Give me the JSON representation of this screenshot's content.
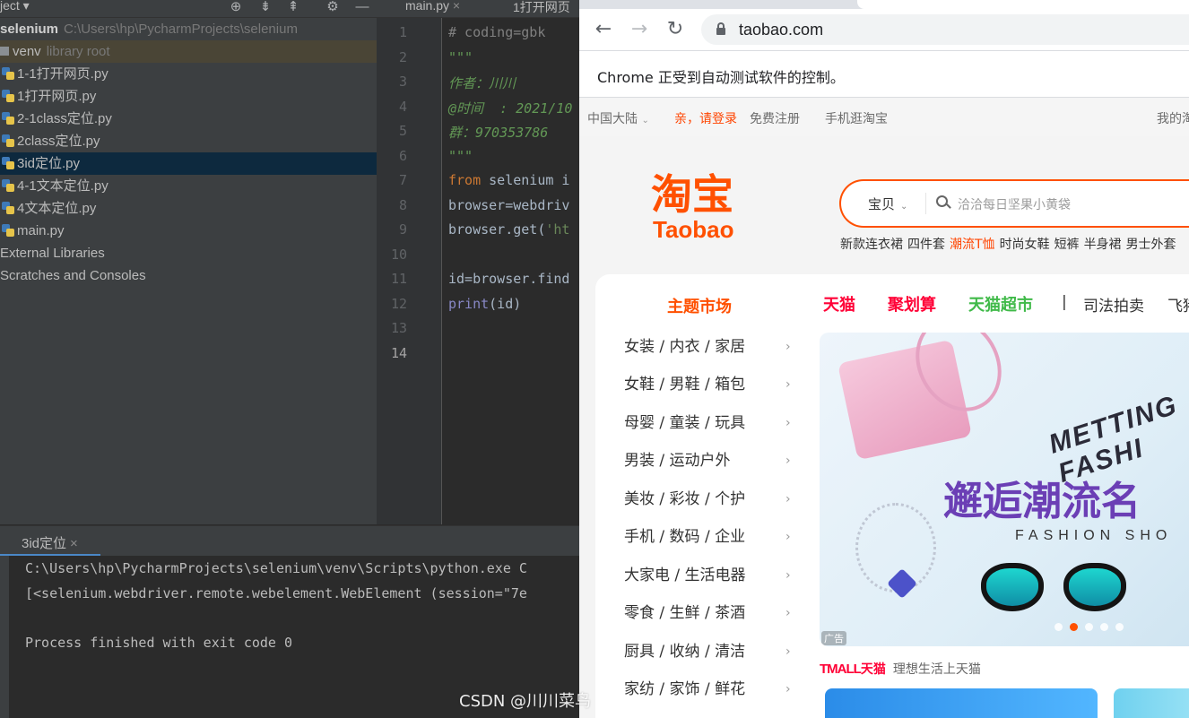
{
  "ide": {
    "project_header": {
      "title": "ject ▾"
    },
    "tree": {
      "root_name": "selenium",
      "root_path": "C:\\Users\\hp\\PycharmProjects\\selenium",
      "venv_name": "venv",
      "venv_note": "library root",
      "files": [
        "1-1打开网页.py",
        "1打开网页.py",
        "2-1class定位.py",
        "2class定位.py",
        "3id定位.py",
        "4-1文本定位.py",
        "4文本定位.py",
        "main.py"
      ],
      "external_libraries": "External Libraries",
      "scratches": "Scratches and Consoles"
    },
    "editor_tabs": [
      "main.py",
      "1打开网页"
    ],
    "line_numbers": [
      "1",
      "2",
      "3",
      "4",
      "5",
      "6",
      "7",
      "8",
      "9",
      "10",
      "11",
      "12",
      "13",
      "14"
    ],
    "code": {
      "l1": "# coding=gbk",
      "l2": "\"\"\"",
      "l3": "作者：川川",
      "l4": "@时间  : 2021/10",
      "l5": "群：970353786",
      "l6": "\"\"\"",
      "l7_kw": "from",
      "l7_rest": " selenium i",
      "l8": "browser=webdriv",
      "l9_a": "browser.get(",
      "l9_b": "'ht",
      "l11": "id=browser.find",
      "l12_fn": "print",
      "l12_rest": "(id)"
    },
    "run": {
      "tab_label": "3id定位",
      "out1": "C:\\Users\\hp\\PycharmProjects\\selenium\\venv\\Scripts\\python.exe C",
      "out2": "[<selenium.webdriver.remote.webelement.WebElement (session=\"7e",
      "out3": "Process finished with exit code 0"
    }
  },
  "browser": {
    "url": "taobao.com",
    "infobar": "Chrome 正受到自动测试软件的控制。",
    "site_nav": {
      "region": "中国大陆",
      "login": "亲，请登录",
      "register": "免费注册",
      "mobile": "手机逛淘宝",
      "my_taobao": "我的淘"
    },
    "logo": {
      "cn": "淘宝",
      "en": "Taobao"
    },
    "search": {
      "scope": "宝贝",
      "placeholder": "洽洽每日坚果小黄袋"
    },
    "hotwords": [
      "新款连衣裙",
      "四件套",
      "潮流T恤",
      "时尚女鞋",
      "短裤",
      "半身裙",
      "男士外套"
    ],
    "category_title": "主题市场",
    "categories": [
      "女装 / 内衣 / 家居",
      "女鞋 / 男鞋 / 箱包",
      "母婴 / 童装 / 玩具",
      "男装 / 运动户外",
      "美妆 / 彩妆 / 个护",
      "手机 / 数码 / 企业",
      "大家电 / 生活电器",
      "零食 / 生鲜 / 茶酒",
      "厨具 / 收纳 / 清洁",
      "家纺 / 家饰 / 鲜花"
    ],
    "channels": {
      "tmall": "天猫",
      "juhuasuan": "聚划算",
      "supermarket": "天猫超市",
      "sep": "|",
      "auction": "司法拍卖",
      "fliggy": "飞猪"
    },
    "banner": {
      "en_top": "METTING FASHI",
      "cn_main": "邂逅潮流名",
      "en_bottom": "FASHION SHO",
      "ad": "广告"
    },
    "tmall_line": {
      "logo": "TMALL",
      "logo_cn": "天猫",
      "slogan": "理想生活上天猫"
    },
    "colors": {
      "taobao_orange": "#ff5000",
      "tmall_red": "#ff0036",
      "chaoshi_green": "#40ba49"
    }
  },
  "watermark": "CSDN @川川菜鸟"
}
